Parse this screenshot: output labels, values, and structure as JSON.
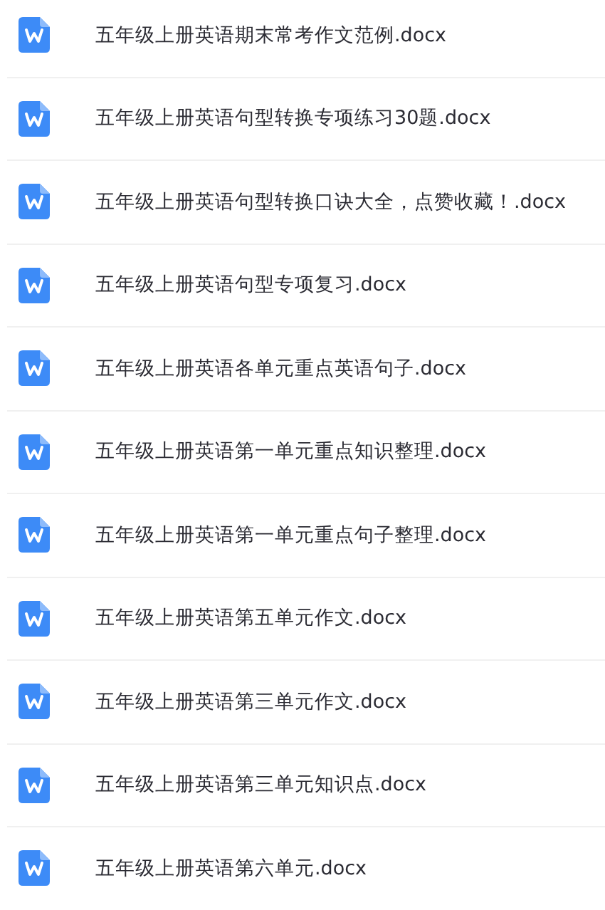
{
  "files": [
    {
      "name": "五年级上册英语期末常考作文范例.docx"
    },
    {
      "name": "五年级上册英语句型转换专项练习30题.docx"
    },
    {
      "name": "五年级上册英语句型转换口诀大全，点赞收藏！.docx"
    },
    {
      "name": "五年级上册英语句型专项复习.docx"
    },
    {
      "name": "五年级上册英语各单元重点英语句子.docx"
    },
    {
      "name": "五年级上册英语第一单元重点知识整理.docx"
    },
    {
      "name": "五年级上册英语第一单元重点句子整理.docx"
    },
    {
      "name": "五年级上册英语第五单元作文.docx"
    },
    {
      "name": "五年级上册英语第三单元作文.docx"
    },
    {
      "name": "五年级上册英语第三单元知识点.docx"
    },
    {
      "name": "五年级上册英语第六单元.docx"
    }
  ]
}
